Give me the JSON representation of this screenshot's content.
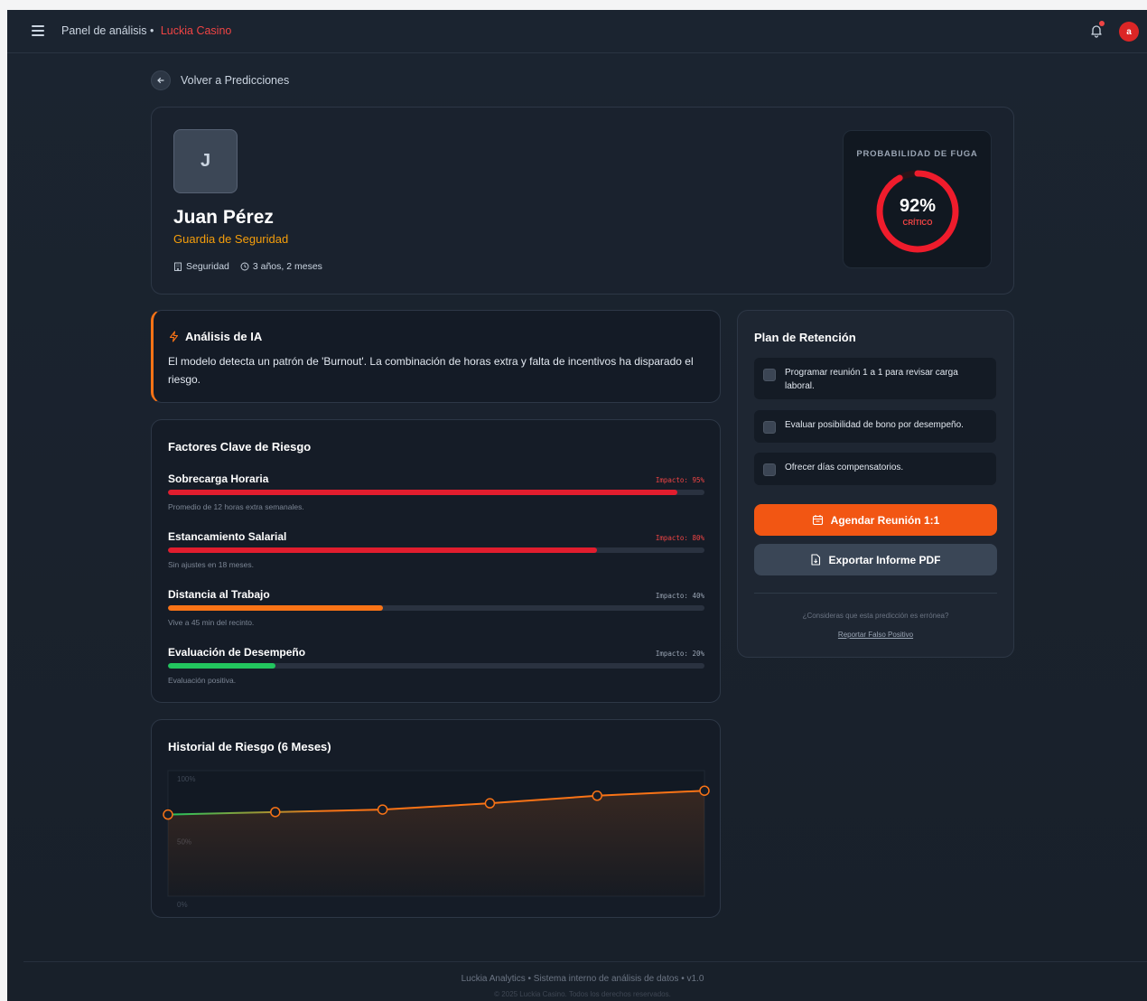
{
  "header": {
    "breadcrumb": "Panel de análisis •",
    "brand": "Luckia Casino",
    "user_initial": "a",
    "menu_icon": "menu-icon",
    "notification_icon": "bell-icon"
  },
  "back": {
    "label": "Volver a Predicciones",
    "icon": "arrow-left-icon"
  },
  "profile": {
    "initial": "J",
    "name": "Juan Pérez",
    "role": "Guardia de Seguridad",
    "department": "Seguridad",
    "tenure": "3 años, 2 meses",
    "probability_title": "PROBABILIDAD DE FUGA",
    "probability_value": "92%",
    "probability_fraction": 0.92,
    "probability_status": "CRÍTICO"
  },
  "ai_analysis": {
    "title": "Análisis de IA",
    "text": "El modelo detecta un patrón de 'Burnout'. La combinación de horas extra y falta de incentivos ha disparado el riesgo."
  },
  "factors": {
    "title": "Factores Clave de Riesgo",
    "items": [
      {
        "name": "Sobrecarga Horaria",
        "impact": "Impacto: 95%",
        "value": 0.95,
        "color": "#e11d2e",
        "desc": "Promedio de 12 horas extra semanales."
      },
      {
        "name": "Estancamiento Salarial",
        "impact": "Impacto: 80%",
        "value": 0.8,
        "color": "#e11d2e",
        "desc": "Sin ajustes en 18 meses."
      },
      {
        "name": "Distancia al Trabajo",
        "impact": "Impacto: 40%",
        "value": 0.4,
        "color": "#f97316",
        "desc": "Vive a 45 min del recinto."
      },
      {
        "name": "Evaluación de Desempeño",
        "impact": "Impacto: 20%",
        "value": 0.2,
        "color": "#22c55e",
        "desc": "Evaluación positiva."
      }
    ]
  },
  "history": {
    "title": "Historial de Riesgo (6 Meses)"
  },
  "chart_data": {
    "type": "line",
    "title": "Historial de Riesgo (6 Meses)",
    "x": [
      1,
      2,
      3,
      4,
      5,
      6
    ],
    "values": [
      65,
      67,
      69,
      74,
      80,
      84
    ],
    "ylim": [
      0,
      100
    ],
    "ytick_labels": [
      "100%",
      "50%",
      "0%"
    ],
    "xlabel": "",
    "ylabel": "",
    "grid": false,
    "colors": {
      "start": "#22c55e",
      "end": "#f97316"
    }
  },
  "plan": {
    "title": "Plan de Retención",
    "tasks": [
      "Programar reunión 1 a 1 para revisar carga laboral.",
      "Evaluar posibilidad de bono por desempeño.",
      "Ofrecer días compensatorios."
    ],
    "primary_button": "Agendar Reunión 1:1",
    "secondary_button": "Exportar Informe PDF",
    "question": "¿Consideras que esta predicción es errónea?",
    "report_link": "Reportar Falso Positivo"
  },
  "footer": {
    "line1": "Luckia Analytics • Sistema interno de análisis de datos • v1.0",
    "line2": "© 2025 Luckia Casino. Todos los derechos reservados."
  },
  "colors": {
    "accent": "#f25613",
    "danger": "#ef4444",
    "warning": "#f59e0b"
  }
}
